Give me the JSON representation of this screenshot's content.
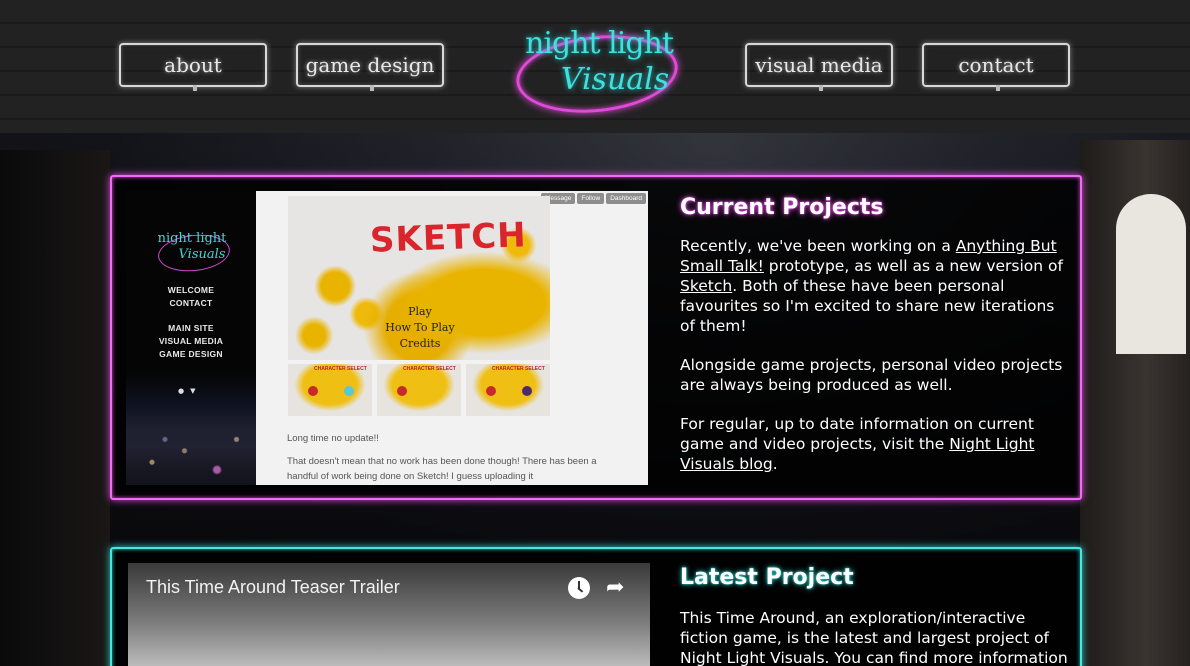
{
  "nav": {
    "about": "about",
    "game_design": "game design",
    "visual_media": "visual media",
    "contact": "contact"
  },
  "logo": {
    "line1": "night light",
    "line2": "Visuals"
  },
  "current_projects": {
    "title": "Current Projects",
    "p1_before": "Recently, we've been working on a ",
    "p1_link1": "Anything But Small Talk!",
    "p1_mid": " prototype, as well as a new version of ",
    "p1_link2": "Sketch",
    "p1_after": ". Both of these have been personal favourites so I'm excited to share new iterations of them!",
    "p2": "Alongside game projects, personal video projects are always being produced as well.",
    "p3_before": "For regular, up to date information on current game and video projects, visit the ",
    "p3_link": "Night Light Visuals blog",
    "p3_after": ".",
    "mini_site": {
      "logo_line1": "night light",
      "logo_line2": "Visuals",
      "menu_a": [
        "WELCOME",
        "CONTACT"
      ],
      "menu_b": [
        "MAIN SITE",
        "VISUAL MEDIA",
        "GAME DESIGN"
      ]
    },
    "blog_shot": {
      "bar": [
        "Message",
        "Follow",
        "Dashboard"
      ],
      "game_title": "SKETCH",
      "game_menu": [
        "Play",
        "How To Play",
        "Credits"
      ],
      "thumb_title": "CHARACTER SELECT",
      "p1": "Long time no update!!",
      "p2": "That doesn't mean that no work has been done though! There has been a handful of work being done on Sketch! I guess uploading it"
    }
  },
  "latest_project": {
    "title": "Latest Project",
    "video_title": "This Time Around Teaser Trailer",
    "text": "This Time Around, an exploration/interactive fiction game, is the latest and largest project of Night Light Visuals. You can find more information"
  }
}
